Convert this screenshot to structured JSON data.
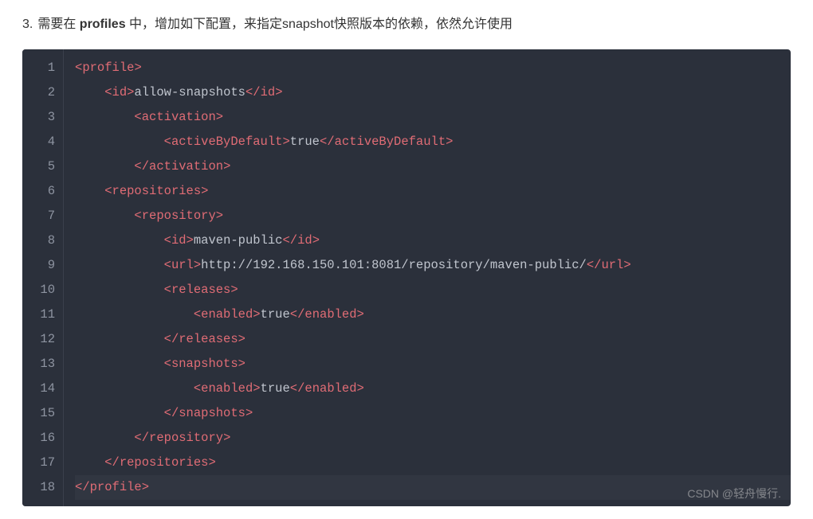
{
  "instruction": {
    "list_number": "3.",
    "pre": "需要在 ",
    "bold": "profiles",
    "post": " 中，增加如下配置，来指定snapshot快照版本的依赖，依然允许使用"
  },
  "tags": {
    "profile_open": "profile",
    "profile_close": "/profile",
    "id_open": "id",
    "id_close": "/id",
    "activation_open": "activation",
    "activation_close": "/activation",
    "activebydefault_open": "activeByDefault",
    "activebydefault_close": "/activeByDefault",
    "repositories_open": "repositories",
    "repositories_close": "/repositories",
    "repository_open": "repository",
    "repository_close": "/repository",
    "url_open": "url",
    "url_close": "/url",
    "releases_open": "releases",
    "releases_close": "/releases",
    "enabled_open": "enabled",
    "enabled_close": "/enabled",
    "snapshots_open": "snapshots",
    "snapshots_close": "/snapshots"
  },
  "values": {
    "allow_snapshots": "allow-snapshots",
    "true": "true",
    "maven_public": "maven-public",
    "url": "http://192.168.150.101:8081/repository/maven-public/"
  },
  "gutter": {
    "l1": "1",
    "l2": "2",
    "l3": "3",
    "l4": "4",
    "l5": "5",
    "l6": "6",
    "l7": "7",
    "l8": "8",
    "l9": "9",
    "l10": "10",
    "l11": "11",
    "l12": "12",
    "l13": "13",
    "l14": "14",
    "l15": "15",
    "l16": "16",
    "l17": "17",
    "l18": "18"
  },
  "watermark": "CSDN @轻舟慢行."
}
